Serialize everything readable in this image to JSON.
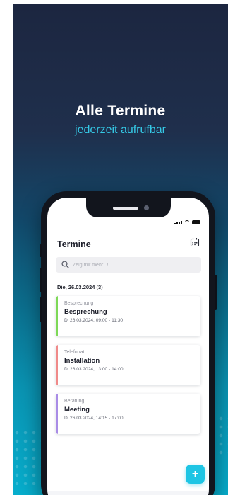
{
  "promo": {
    "title": "Alle Termine",
    "subtitle": "jederzeit aufrufbar"
  },
  "app": {
    "title": "Termine",
    "search_placeholder": "Zeig mir mehr...!",
    "date_header": "Die, 26.03.2024 (3)"
  },
  "appointments": [
    {
      "category": "Besprechung",
      "name": "Besprechung",
      "when": "Di 26.03.2024, 09:00 - 11:30",
      "color": "#7ed957"
    },
    {
      "category": "Telefonat",
      "name": "Installation",
      "when": "Di 26.03.2024, 13:00 - 14:00",
      "color": "#f08a8a"
    },
    {
      "category": "Beratung",
      "name": "Meeting",
      "when": "Di 26.03.2024, 14:15 - 17:00",
      "color": "#a98ce6"
    }
  ],
  "fab": {
    "label": "+"
  },
  "bottom_nav": [
    {
      "icon": "home-icon",
      "active": false
    },
    {
      "icon": "document-icon",
      "active": false
    },
    {
      "icon": "chart-icon",
      "active": false
    },
    {
      "icon": "calendar-icon",
      "active": true
    },
    {
      "icon": "box-icon",
      "active": false
    },
    {
      "icon": "tool-icon",
      "active": false
    },
    {
      "icon": "briefcase-icon",
      "active": false
    },
    {
      "icon": "list-icon",
      "active": false
    }
  ],
  "colors": {
    "accent": "#1ec5e4",
    "active_nav": "#1ec5e4",
    "nav_icon": "#4a4d58"
  }
}
